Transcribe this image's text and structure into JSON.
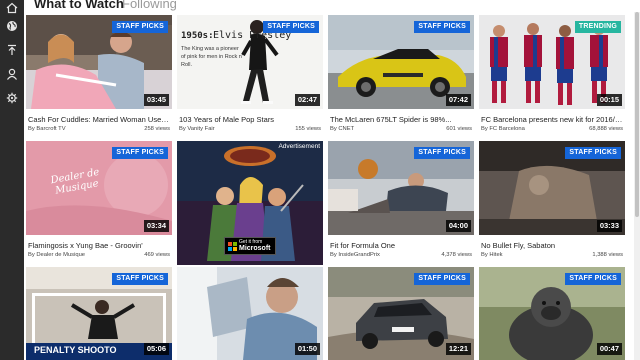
{
  "nav": {
    "icons": [
      "home-icon",
      "globe-icon",
      "upload-icon",
      "person-icon",
      "gear-icon"
    ]
  },
  "tabs": [
    {
      "label": "What to Watch",
      "active": true
    },
    {
      "label": "Following",
      "active": false
    }
  ],
  "videos": [
    {
      "title": "Cash For Cuddles: Married Woman Uses...",
      "by": "By Barcroft TV",
      "views": "258 views",
      "duration": "03:45",
      "badge": "STAFF PICKS"
    },
    {
      "title": "103 Years of Male Pop Stars",
      "by": "By Vanity Fair",
      "views": "155 views",
      "duration": "02:47",
      "badge": "STAFF PICKS",
      "thumb_text": {
        "heading": "1950s:",
        "name": "Elvis Presley",
        "caption": "The King was a pioneer of pink for men in Rock n' Roll."
      }
    },
    {
      "title": "The McLaren 675LT Spider is 98%...",
      "by": "By CNET",
      "views": "601 views",
      "duration": "07:42",
      "badge": "STAFF PICKS"
    },
    {
      "title": "FC Barcelona presents new kit for 2016/17",
      "by": "By FC Barcelona",
      "views": "68,888 views",
      "duration": "00:15",
      "badge": "TRENDING"
    },
    {
      "title": "Flamingosis x Yung Bae - Groovin'",
      "by": "By Dealer de Musique",
      "views": "469 views",
      "duration": "03:34",
      "badge": "STAFF PICKS",
      "thumb_text": {
        "logo": "Dealer de Musique"
      }
    },
    {
      "ad": true,
      "ad_label": "Advertisement",
      "store": {
        "small": "Get it from",
        "big": "Microsoft"
      }
    },
    {
      "title": "Fit for Formula One",
      "by": "By InsideGrandPrix",
      "views": "4,378 views",
      "duration": "04:00",
      "badge": "STAFF PICKS"
    },
    {
      "title": "No Bullet Fly, Sabaton",
      "by": "By Hitek",
      "views": "1,388 views",
      "duration": "03:33",
      "badge": "STAFF PICKS"
    },
    {
      "duration": "05:06",
      "badge": "STAFF PICKS",
      "thumb_text": {
        "banner": "PENALTY SHOOTO"
      }
    },
    {
      "duration": "01:50"
    },
    {
      "duration": "12:21",
      "badge": "STAFF PICKS"
    },
    {
      "duration": "00:47",
      "badge": "STAFF PICKS"
    }
  ],
  "colors": {
    "staff_picks": "#1565d8",
    "trending": "#27b6a0",
    "sidebar": "#2b2b2b"
  }
}
